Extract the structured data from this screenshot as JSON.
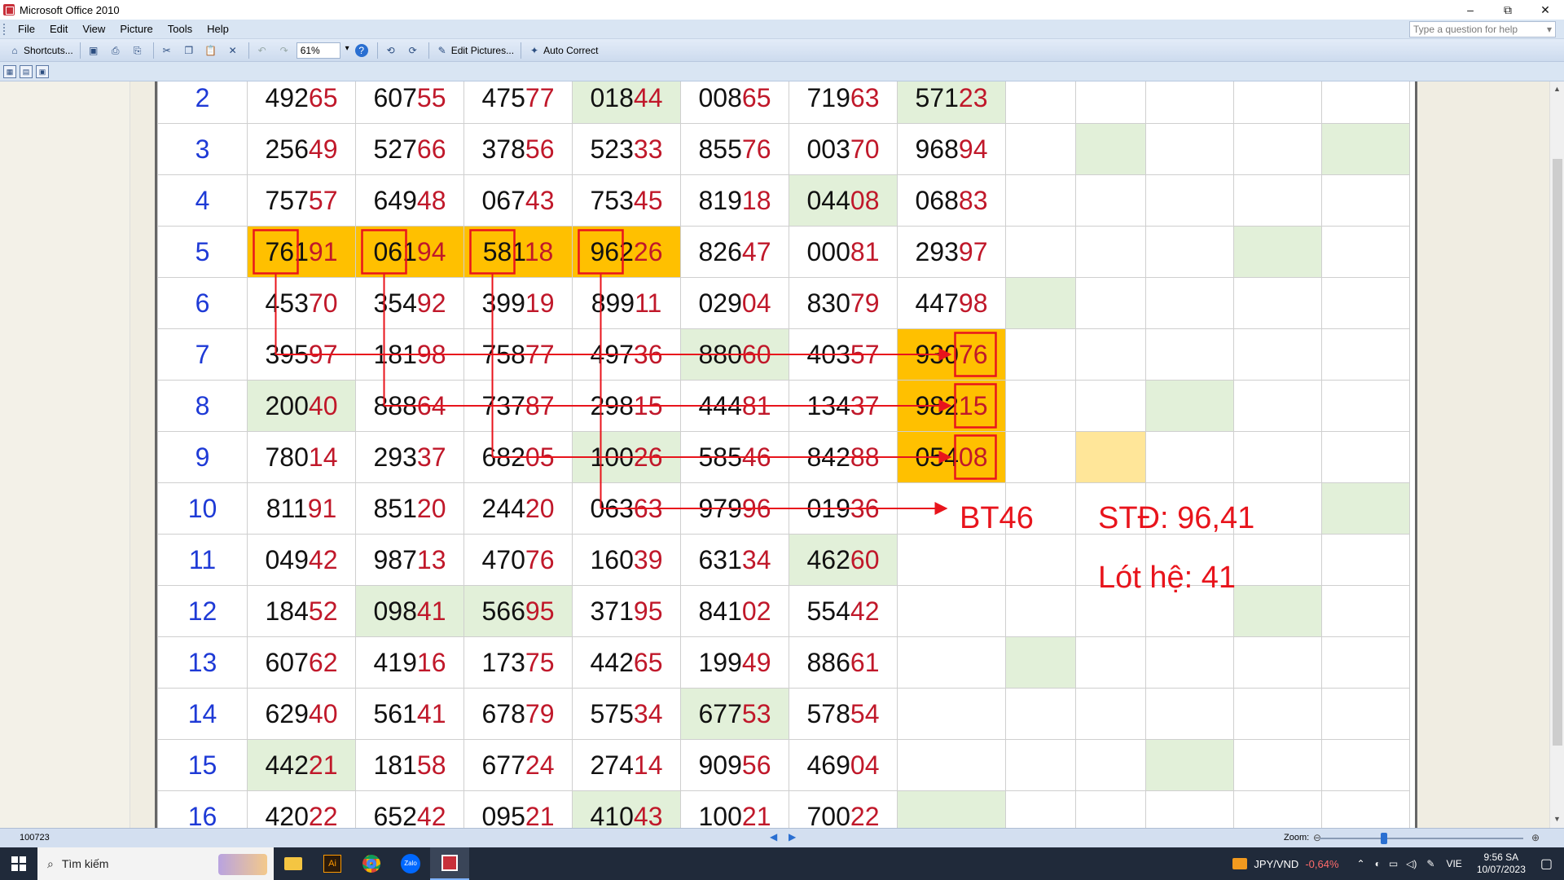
{
  "window": {
    "title": "Microsoft Office 2010"
  },
  "menu": [
    "File",
    "Edit",
    "View",
    "Picture",
    "Tools",
    "Help"
  ],
  "help_placeholder": "Type a question for help",
  "toolbar": {
    "shortcuts": "Shortcuts...",
    "zoom": "61%",
    "edit_pictures": "Edit Pictures...",
    "auto_correct": "Auto Correct"
  },
  "table": {
    "rows": [
      {
        "n": "2",
        "cells": [
          [
            "492",
            "65"
          ],
          [
            "607",
            "55"
          ],
          [
            "475",
            "77"
          ],
          [
            "018",
            "44"
          ],
          [
            "008",
            "65"
          ],
          [
            "719",
            "63"
          ],
          [
            "571",
            "23"
          ]
        ]
      },
      {
        "n": "3",
        "cells": [
          [
            "256",
            "49"
          ],
          [
            "527",
            "66"
          ],
          [
            "378",
            "56"
          ],
          [
            "523",
            "33"
          ],
          [
            "855",
            "76"
          ],
          [
            "003",
            "70"
          ],
          [
            "968",
            "94"
          ]
        ]
      },
      {
        "n": "4",
        "cells": [
          [
            "757",
            "57"
          ],
          [
            "649",
            "48"
          ],
          [
            "067",
            "43"
          ],
          [
            "753",
            "45"
          ],
          [
            "819",
            "18"
          ],
          [
            "044",
            "08"
          ],
          [
            "068",
            "83"
          ]
        ]
      },
      {
        "n": "5",
        "cells": [
          [
            "761",
            "91"
          ],
          [
            "061",
            "94"
          ],
          [
            "581",
            "18"
          ],
          [
            "962",
            "26"
          ],
          [
            "826",
            "47"
          ],
          [
            "000",
            "81"
          ],
          [
            "293",
            "97"
          ]
        ]
      },
      {
        "n": "6",
        "cells": [
          [
            "453",
            "70"
          ],
          [
            "354",
            "92"
          ],
          [
            "399",
            "19"
          ],
          [
            "899",
            "11"
          ],
          [
            "029",
            "04"
          ],
          [
            "830",
            "79"
          ],
          [
            "447",
            "98"
          ]
        ]
      },
      {
        "n": "7",
        "cells": [
          [
            "395",
            "97"
          ],
          [
            "181",
            "98"
          ],
          [
            "758",
            "77"
          ],
          [
            "497",
            "36"
          ],
          [
            "880",
            "60"
          ],
          [
            "403",
            "57"
          ],
          [
            "930",
            "76"
          ]
        ]
      },
      {
        "n": "8",
        "cells": [
          [
            "200",
            "40"
          ],
          [
            "888",
            "64"
          ],
          [
            "737",
            "87"
          ],
          [
            "298",
            "15"
          ],
          [
            "444",
            "81"
          ],
          [
            "134",
            "37"
          ],
          [
            "982",
            "15"
          ]
        ]
      },
      {
        "n": "9",
        "cells": [
          [
            "780",
            "14"
          ],
          [
            "293",
            "37"
          ],
          [
            "682",
            "05"
          ],
          [
            "100",
            "26"
          ],
          [
            "585",
            "46"
          ],
          [
            "842",
            "88"
          ],
          [
            "054",
            "08"
          ]
        ]
      },
      {
        "n": "10",
        "cells": [
          [
            "811",
            "91"
          ],
          [
            "851",
            "20"
          ],
          [
            "244",
            "20"
          ],
          [
            "063",
            "63"
          ],
          [
            "979",
            "96"
          ],
          [
            "019",
            "36"
          ],
          [
            "",
            ""
          ]
        ]
      },
      {
        "n": "11",
        "cells": [
          [
            "049",
            "42"
          ],
          [
            "987",
            "13"
          ],
          [
            "470",
            "76"
          ],
          [
            "160",
            "39"
          ],
          [
            "631",
            "34"
          ],
          [
            "462",
            "60"
          ],
          [
            "",
            ""
          ]
        ]
      },
      {
        "n": "12",
        "cells": [
          [
            "184",
            "52"
          ],
          [
            "098",
            "41"
          ],
          [
            "566",
            "95"
          ],
          [
            "371",
            "95"
          ],
          [
            "841",
            "02"
          ],
          [
            "554",
            "42"
          ],
          [
            "",
            ""
          ]
        ]
      },
      {
        "n": "13",
        "cells": [
          [
            "607",
            "62"
          ],
          [
            "419",
            "16"
          ],
          [
            "173",
            "75"
          ],
          [
            "442",
            "65"
          ],
          [
            "199",
            "49"
          ],
          [
            "886",
            "61"
          ],
          [
            "",
            ""
          ]
        ]
      },
      {
        "n": "14",
        "cells": [
          [
            "629",
            "40"
          ],
          [
            "561",
            "41"
          ],
          [
            "678",
            "79"
          ],
          [
            "575",
            "34"
          ],
          [
            "677",
            "53"
          ],
          [
            "578",
            "54"
          ],
          [
            "",
            ""
          ]
        ]
      },
      {
        "n": "15",
        "cells": [
          [
            "442",
            "21"
          ],
          [
            "181",
            "58"
          ],
          [
            "677",
            "24"
          ],
          [
            "274",
            "14"
          ],
          [
            "909",
            "56"
          ],
          [
            "469",
            "04"
          ],
          [
            "",
            ""
          ]
        ]
      },
      {
        "n": "16",
        "cells": [
          [
            "420",
            "22"
          ],
          [
            "652",
            "42"
          ],
          [
            "095",
            "21"
          ],
          [
            "410",
            "43"
          ],
          [
            "100",
            "21"
          ],
          [
            "700",
            "22"
          ],
          [
            "",
            ""
          ]
        ]
      }
    ]
  },
  "annotations": {
    "bt": "BT46",
    "std": "STĐ: 96,41",
    "lot": "Lót hệ: 41"
  },
  "status": {
    "page": "100723",
    "zoom_label": "Zoom:",
    "zoom_fraction": 0.3
  },
  "taskbar": {
    "search": "Tìm kiếm",
    "ticker": "JPY/VND",
    "ticker_change": "-0,64%",
    "lang": "VIE",
    "time": "9:56 SA",
    "date": "10/07/2023"
  }
}
